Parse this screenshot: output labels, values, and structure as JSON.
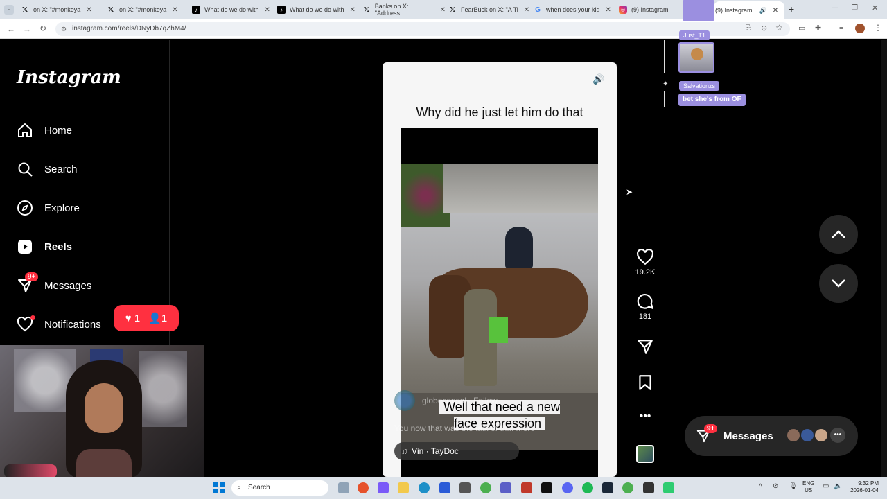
{
  "browser": {
    "tabs": [
      {
        "title": "on X: \"#monkeya",
        "icon": "x-icon"
      },
      {
        "title": "on X: \"#monkeya",
        "icon": "x-icon"
      },
      {
        "title": "What do we do with",
        "icon": "tiktok-icon"
      },
      {
        "title": "What do we do with",
        "icon": "tiktok-icon"
      },
      {
        "title": "Banks on X: \"Address",
        "icon": "x-icon"
      },
      {
        "title": "FearBuck on X: \"A Ti",
        "icon": "x-icon"
      },
      {
        "title": "when does your kid",
        "icon": "google-icon"
      },
      {
        "title": "(9) Instagram",
        "icon": "instagram-icon"
      },
      {
        "title": "(9) Instagram",
        "icon": "instagram-icon",
        "active": true
      }
    ],
    "url": "instagram.com/reels/DNyDb7qZhM4/"
  },
  "sidebar": {
    "logo": "Instagram",
    "items": [
      {
        "label": "Home",
        "icon": "home-icon"
      },
      {
        "label": "Search",
        "icon": "search-icon"
      },
      {
        "label": "Explore",
        "icon": "compass-icon"
      },
      {
        "label": "Reels",
        "icon": "reels-icon",
        "active": true
      },
      {
        "label": "Messages",
        "icon": "messenger-icon",
        "badge": "9+"
      },
      {
        "label": "Notifications",
        "icon": "heart-icon"
      }
    ],
    "notif_popup": {
      "likes": "1",
      "follows": "1"
    }
  },
  "reel": {
    "caption_top": "Why did he just let him do that",
    "overlay_text": "Well that need a new face expression",
    "account": "globeconsal",
    "follow_label": "Follow",
    "description": "You now that was the talk of th",
    "more_label": "... more",
    "audio": "Vịn · TayDoc"
  },
  "actions": {
    "likes": "19.2K",
    "comments": "181"
  },
  "messages_pill": {
    "label": "Messages",
    "badge": "9+"
  },
  "stream_chat": [
    {
      "user": "Just_T1"
    },
    {
      "user": "Salvationzs",
      "message": "bet she's from OF"
    }
  ],
  "taskbar": {
    "search_label": "Search",
    "lang_top": "ENG",
    "lang_bottom": "US",
    "time": "9:32 PM",
    "date": "2026-01-04"
  },
  "colors": {
    "accent_red": "#ff3040",
    "chat_purple": "#9b8fe0",
    "ig_bg": "#000000"
  }
}
